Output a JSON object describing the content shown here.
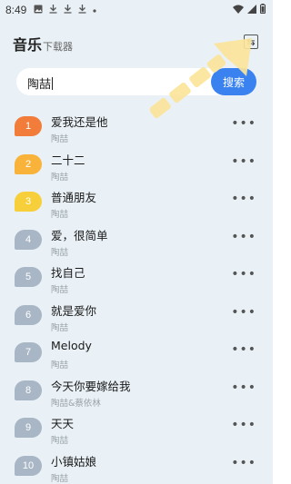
{
  "status_bar": {
    "time": "8:49",
    "icons": [
      "image-icon",
      "download-icon",
      "download-icon",
      "download-icon",
      "dot-icon"
    ],
    "right_icons": [
      "wifi-icon",
      "signal-icon",
      "battery-icon"
    ]
  },
  "header": {
    "title": "音乐",
    "subtitle": "下载器",
    "switch_icon": "switch-icon",
    "switch_glyph": "⇆"
  },
  "search": {
    "value": "陶喆",
    "button_label": "搜索"
  },
  "colors": {
    "rank1": "#f27d3a",
    "rank2": "#f9b33a",
    "rank3": "#f7cf3a",
    "rank_other": "#a9b6c6",
    "accent": "#3a82f0",
    "hint_arrow": "#fbe59a"
  },
  "songs": [
    {
      "rank": "1",
      "title": "爱我还是他",
      "artist": "陶喆"
    },
    {
      "rank": "2",
      "title": "二十二",
      "artist": "陶喆"
    },
    {
      "rank": "3",
      "title": "普通朋友",
      "artist": "陶喆"
    },
    {
      "rank": "4",
      "title": "爱，很简单",
      "artist": "陶喆"
    },
    {
      "rank": "5",
      "title": "找自己",
      "artist": "陶喆"
    },
    {
      "rank": "6",
      "title": "就是爱你",
      "artist": "陶喆"
    },
    {
      "rank": "7",
      "title": "Melody",
      "artist": "陶喆"
    },
    {
      "rank": "8",
      "title": "今天你要嫁给我",
      "artist": "陶喆&蔡依林"
    },
    {
      "rank": "9",
      "title": "天天",
      "artist": "陶喆"
    },
    {
      "rank": "10",
      "title": "小镇姑娘",
      "artist": "陶喆"
    }
  ],
  "more_label": "•••"
}
